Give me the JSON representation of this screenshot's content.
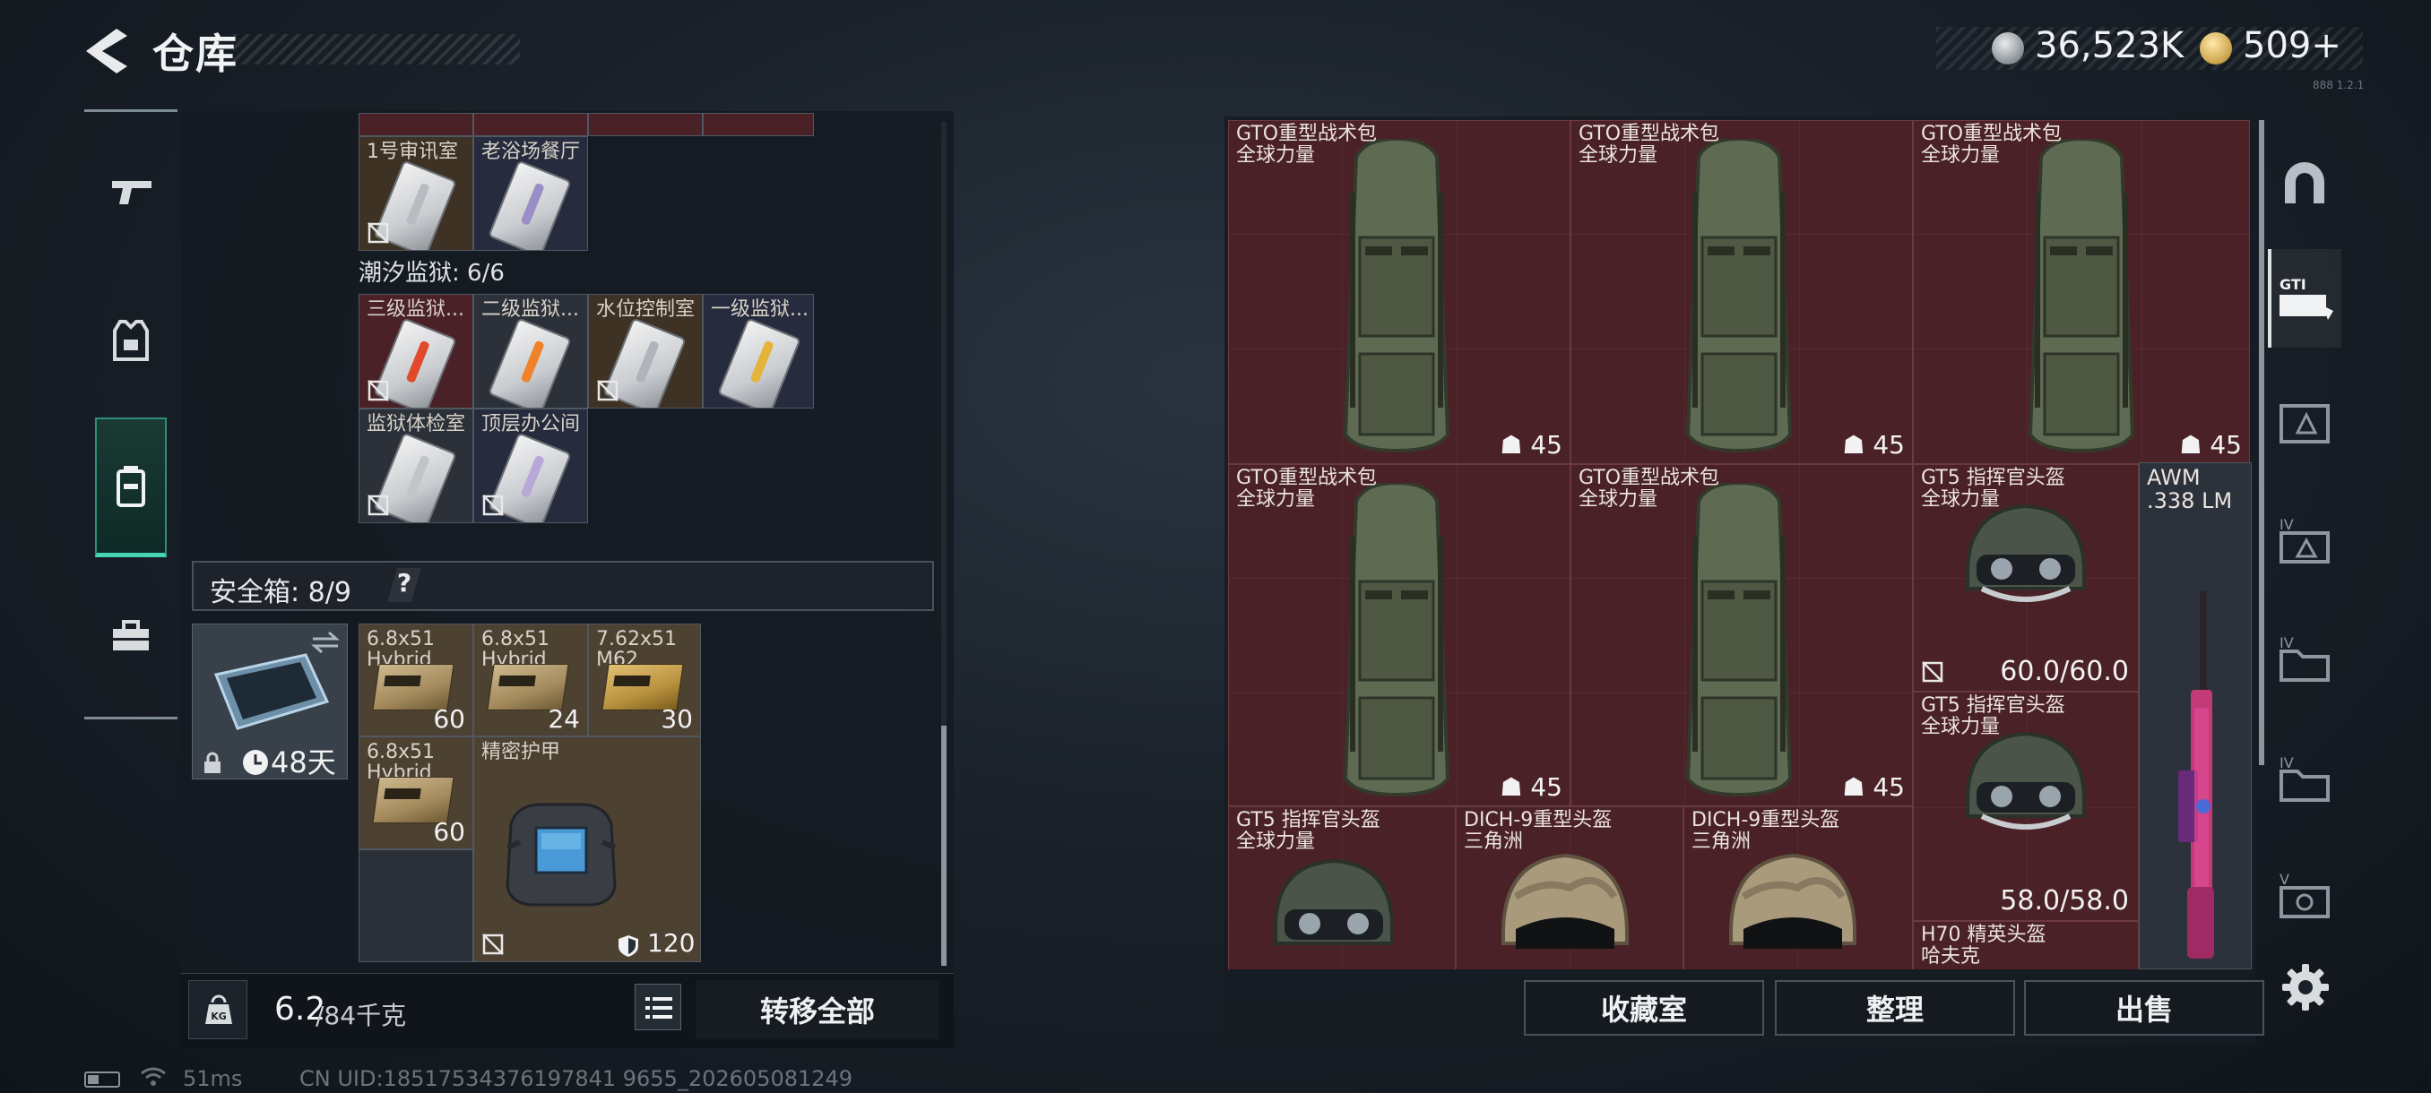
{
  "header": {
    "title": "仓库",
    "currency_silver": "36,523K",
    "currency_gold": "509+",
    "version": "888 1.2.1"
  },
  "left_rail": {
    "items": [
      {
        "name": "weapons",
        "icon": "pistol-icon"
      },
      {
        "name": "equipment",
        "icon": "armor-vest-icon"
      },
      {
        "name": "containers",
        "icon": "backpack-icon",
        "active": true
      },
      {
        "name": "items",
        "icon": "toolbox-icon"
      }
    ]
  },
  "storage": {
    "partial_row_labels": [
      "1号审讯室",
      "老浴场餐厅"
    ],
    "tidal_section": "潮汐监狱: 6/6",
    "tidal_keys": [
      {
        "label": "三级监狱...",
        "strip": "#e04a2a",
        "bg": "red"
      },
      {
        "label": "二级监狱...",
        "strip": "#f0822a",
        "bg": "dark"
      },
      {
        "label": "水位控制室",
        "strip": "#b0b4ba",
        "bg": "olive"
      },
      {
        "label": "一级监狱...",
        "strip": "#e4b43a",
        "bg": "navy"
      },
      {
        "label": "监狱体检室",
        "strip": "#c2c4c8",
        "bg": "dark"
      },
      {
        "label": "顶层办公间",
        "strip": "#b8a8d8",
        "bg": "navy"
      }
    ],
    "safe_box": {
      "title": "安全箱: 8/9",
      "help": "?",
      "timer": "48天"
    },
    "safe_items": [
      {
        "name": "6.8x51",
        "sub": "Hybrid",
        "count": "60"
      },
      {
        "name": "6.8x51",
        "sub": "Hybrid",
        "count": "24"
      },
      {
        "name": "7.62x51",
        "sub": "M62",
        "count": "30"
      },
      {
        "name": "6.8x51",
        "sub": "Hybrid",
        "count": "60"
      }
    ],
    "armor": {
      "name": "精密护甲",
      "durability": "120"
    }
  },
  "bottom_left": {
    "weight_value": "6.2",
    "weight_max": "/84千克",
    "transfer_all": "转移全部"
  },
  "status": {
    "ping": "51ms",
    "uid": "CN UID:18517534376197841 9655_202605081249"
  },
  "container": {
    "backpacks": [
      {
        "name": "GTO重型战术包",
        "sub": "全球力量",
        "level": "45"
      },
      {
        "name": "GTO重型战术包",
        "sub": "全球力量",
        "level": "45"
      },
      {
        "name": "GTO重型战术包",
        "sub": "全球力量",
        "level": "45"
      },
      {
        "name": "GTO重型战术包",
        "sub": "全球力量",
        "level": "45"
      },
      {
        "name": "GTO重型战术包",
        "sub": "全球力量",
        "level": "45"
      }
    ],
    "helmets": [
      {
        "name": "GT5 指挥官头盔",
        "sub": "全球力量",
        "durability": "60.0/60.0"
      },
      {
        "name": "GT5 指挥官头盔",
        "sub": "全球力量",
        "durability": "58.0/58.0"
      },
      {
        "name": "GT5 指挥官头盔",
        "sub": "全球力量"
      },
      {
        "name": "DICH-9重型头盔",
        "sub": "三角洲"
      },
      {
        "name": "DICH-9重型头盔",
        "sub": "三角洲"
      },
      {
        "name": "H70 精英头盔",
        "sub": "哈夫克"
      }
    ],
    "weapon": {
      "name": "AWM",
      "sub": ".338 LM"
    }
  },
  "bottom_right": {
    "collection": "收藏室",
    "sort": "整理",
    "sell": "出售"
  },
  "right_rail": {
    "items": [
      {
        "name": "safehouse",
        "icon": "dome-icon"
      },
      {
        "name": "gti-container",
        "icon": "gti-crate-icon",
        "active": true
      },
      {
        "name": "container-tab-3",
        "icon": "crate-tab-icon"
      },
      {
        "name": "container-tab-4",
        "icon": "crate-tab-icon"
      },
      {
        "name": "container-tab-5",
        "icon": "folder-tab-icon"
      },
      {
        "name": "container-tab-6",
        "icon": "folder-tab-icon"
      },
      {
        "name": "container-tab-7",
        "icon": "crate-tab-icon"
      }
    ]
  },
  "colors": {
    "accent_teal": "#45d6b1",
    "cell_red": "#4a2126"
  }
}
